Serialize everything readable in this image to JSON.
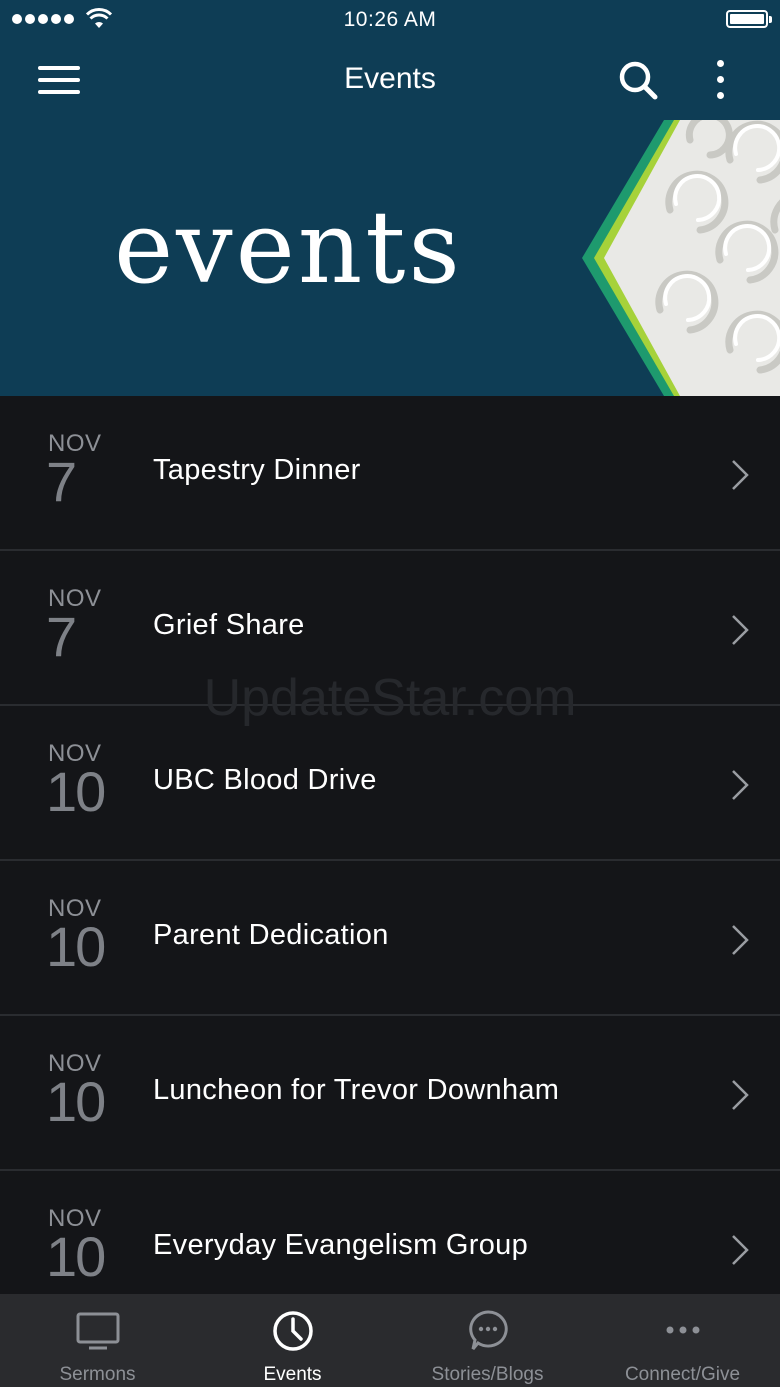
{
  "status_bar": {
    "time": "10:26 AM"
  },
  "header": {
    "title": "Events"
  },
  "banner": {
    "text": "events"
  },
  "events": [
    {
      "month": "NOV",
      "day": "7",
      "title": "Tapestry Dinner"
    },
    {
      "month": "NOV",
      "day": "7",
      "title": "Grief Share"
    },
    {
      "month": "NOV",
      "day": "10",
      "title": "UBC Blood Drive"
    },
    {
      "month": "NOV",
      "day": "10",
      "title": "Parent Dedication"
    },
    {
      "month": "NOV",
      "day": "10",
      "title": "Luncheon for Trevor Downham"
    },
    {
      "month": "NOV",
      "day": "10",
      "title": "Everyday Evangelism Group"
    }
  ],
  "watermark": "UpdateStar.com",
  "tabs": [
    {
      "label": "Sermons",
      "icon": "monitor-icon",
      "active": false
    },
    {
      "label": "Events",
      "icon": "clock-icon",
      "active": true
    },
    {
      "label": "Stories/Blogs",
      "icon": "chat-bubble-icon",
      "active": false
    },
    {
      "label": "Connect/Give",
      "icon": "more-dots-icon",
      "active": false
    }
  ],
  "colors": {
    "header_bg": "#0e3d55",
    "list_bg": "#141518",
    "tab_bar_bg": "#2a2b2e",
    "accent_green": "#1e9a6e",
    "accent_lime": "#a6d23a"
  }
}
